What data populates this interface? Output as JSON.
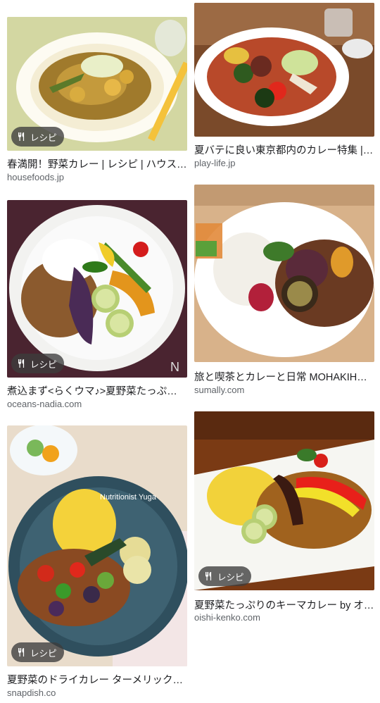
{
  "badge_label": "レシピ",
  "results": [
    {
      "title": "春満開！野菜カレー | レシピ | ハウス食品",
      "source": "housefoods.jp",
      "badge": true
    },
    {
      "title": "夏バテに良い東京都内のカレー特集 | Play Life",
      "source": "play-life.jp",
      "badge": false
    },
    {
      "title": "煮込まず<らくウマ♪>夏野菜たっぷりカレー",
      "source": "oceans-nadia.com",
      "badge": true
    },
    {
      "title": "旅と喫茶とカレーと日常 MOHAKIHOMI",
      "source": "sumally.com",
      "badge": false
    },
    {
      "title": "夏野菜のドライカレー ターメリックライス添え",
      "source": "snapdish.co",
      "badge": true,
      "image_caption": "Nutritionist Yuga"
    },
    {
      "title": "夏野菜たっぷりのキーマカレー by オイシイ健康",
      "source": "oishi-kenko.com",
      "badge": true
    }
  ]
}
